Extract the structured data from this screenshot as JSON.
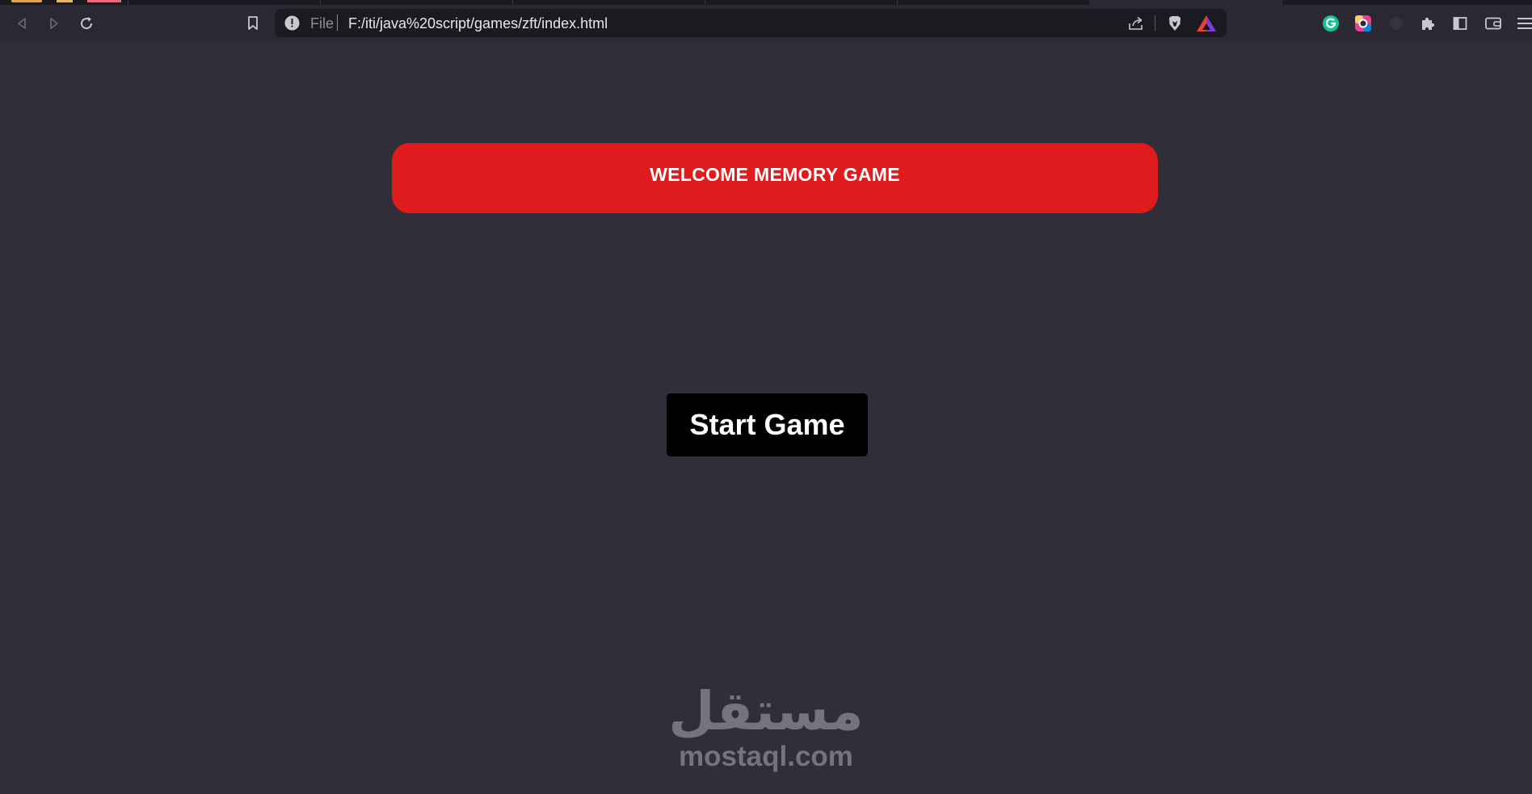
{
  "browser": {
    "address_bar": {
      "scheme_label": "File",
      "url": "F:/iti/java%20script/games/zft/index.html"
    },
    "icons": {
      "back": "back-arrow-icon",
      "forward": "forward-arrow-icon",
      "reload": "reload-icon",
      "bookmark": "bookmark-icon",
      "site_info": "info-icon",
      "share": "share-icon",
      "brave_shields": "brave-shield-icon",
      "brave_rewards": "brave-rewards-icon",
      "grammarly": "grammarly-icon",
      "color_extension": "color-ring-icon",
      "extensions": "puzzle-icon",
      "sidebar": "sidebar-icon",
      "wallet": "wallet-icon",
      "menu": "hamburger-menu-icon"
    }
  },
  "game": {
    "title": "WELCOME MEMORY GAME",
    "start_button_label": "Start Game"
  },
  "watermark": {
    "arabic": "مستقل",
    "latin": "mostaql.com"
  },
  "colors": {
    "page_background": "#312e3a",
    "banner": "#e01b1e",
    "button": "#000000",
    "watermark": "#75737c"
  }
}
